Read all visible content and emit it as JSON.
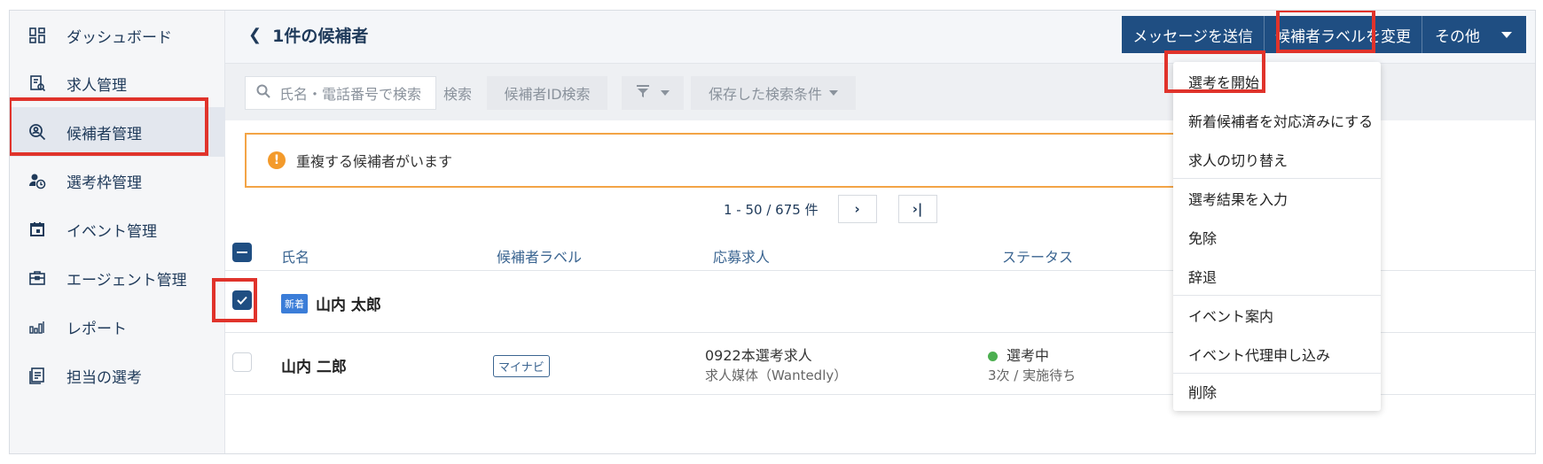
{
  "sidebar": {
    "items": [
      {
        "label": "ダッシュボード",
        "icon": "dashboard-icon"
      },
      {
        "label": "求人管理",
        "icon": "job-icon"
      },
      {
        "label": "候補者管理",
        "icon": "candidate-search-icon"
      },
      {
        "label": "選考枠管理",
        "icon": "schedule-slot-icon"
      },
      {
        "label": "イベント管理",
        "icon": "calendar-icon"
      },
      {
        "label": "エージェント管理",
        "icon": "briefcase-icon"
      },
      {
        "label": "レポート",
        "icon": "bar-chart-icon"
      },
      {
        "label": "担当の選考",
        "icon": "assigned-icon"
      }
    ]
  },
  "header": {
    "title": "1件の候補者",
    "buttons": {
      "send_message": "メッセージを送信",
      "change_label": "候補者ラベルを変更",
      "other": "その他"
    }
  },
  "search": {
    "placeholder": "氏名・電話番号で検索",
    "search_button": "検索",
    "id_search": "候補者ID検索",
    "saved_conditions": "保存した検索条件"
  },
  "alert": {
    "text": "重複する候補者がいます"
  },
  "pager": {
    "range": "1 -  50 / 675 件",
    "next": "›",
    "last": "›|"
  },
  "table": {
    "columns": [
      "氏名",
      "候補者ラベル",
      "応募求人",
      "ステータス"
    ],
    "rows": [
      {
        "badge": "新着",
        "name": "山内 太郎",
        "label": "",
        "job": "",
        "job_source": "",
        "status": "",
        "status_sub": "",
        "checked": true
      },
      {
        "badge": "",
        "name": "山内 二郎",
        "label": "マイナビ",
        "job": "0922本選考求人",
        "job_source": "求人媒体（Wantedly）",
        "status": "選考中",
        "status_sub": "3次 / 実施待ち",
        "checked": false
      }
    ]
  },
  "dropdown": {
    "items": [
      "選考を開始",
      "新着候補者を対応済みにする",
      "求人の切り替え",
      "選考結果を入力",
      "免除",
      "辞退",
      "イベント案内",
      "イベント代理申し込み",
      "削除"
    ]
  },
  "colors": {
    "primary": "#1f4e82",
    "highlight": "#e0332b",
    "warning": "#f39a2b",
    "status_green": "#4caf50"
  }
}
